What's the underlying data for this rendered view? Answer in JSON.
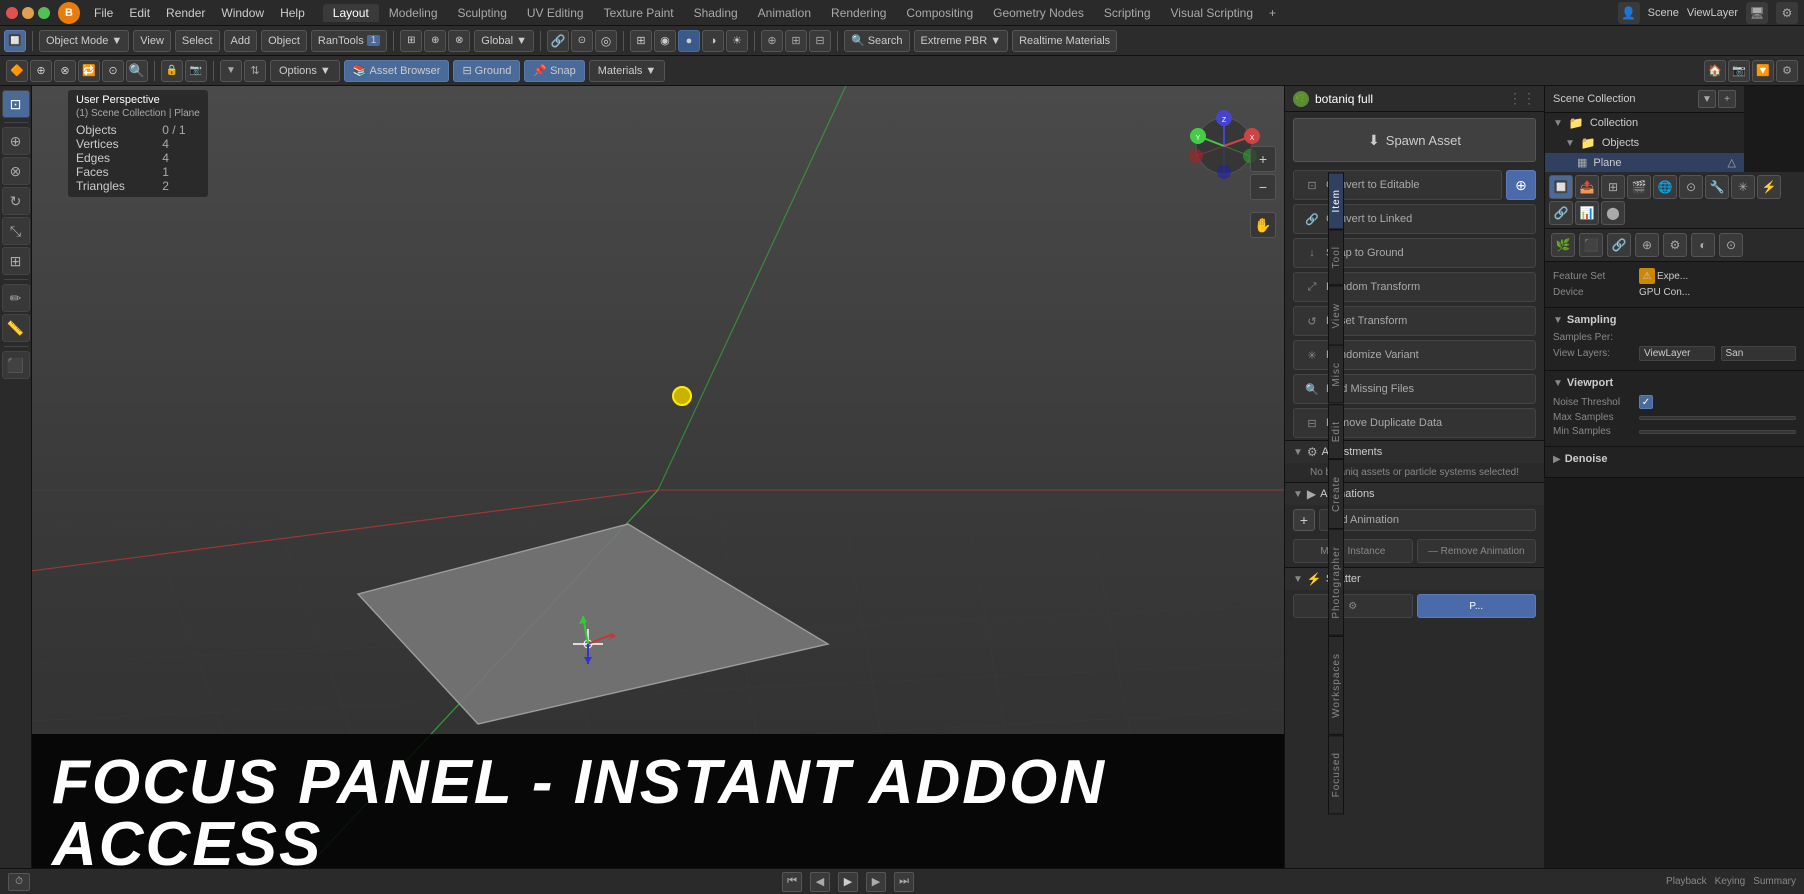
{
  "app": {
    "title": "Blender"
  },
  "top_menu": {
    "items": [
      "File",
      "Edit",
      "Render",
      "Window",
      "Help"
    ]
  },
  "workspace_tabs": {
    "tabs": [
      "Layout",
      "Modeling",
      "Sculpting",
      "UV Editing",
      "Texture Paint",
      "Shading",
      "Animation",
      "Rendering",
      "Compositing",
      "Geometry Nodes",
      "Scripting",
      "Visual Scripting"
    ],
    "active": "Layout",
    "plus_label": "+"
  },
  "toolbar": {
    "mode_label": "Object Mode",
    "view_label": "View",
    "select_label": "Select",
    "add_label": "Add",
    "object_label": "Object",
    "rantools_label": "RanTools",
    "global_label": "Global",
    "search_label": "Search",
    "extreme_pbr_label": "Extreme PBR",
    "realtime_materials_label": "Realtime Materials"
  },
  "editor_toolbar": {
    "options_label": "Options",
    "asset_browser_label": "Asset Browser",
    "ground_label": "Ground",
    "snap_label": "Snap",
    "materials_label": "Materials"
  },
  "info_panel": {
    "header": "User Perspective",
    "sub": "(1) Scene Collection | Plane",
    "rows": [
      {
        "label": "Objects",
        "value": "0 / 1"
      },
      {
        "label": "Vertices",
        "value": "4"
      },
      {
        "label": "Edges",
        "value": "4"
      },
      {
        "label": "Faces",
        "value": "1"
      },
      {
        "label": "Triangles",
        "value": "2"
      }
    ]
  },
  "botaniq_panel": {
    "title": "botaniq full",
    "spawn_asset_label": "Spawn Asset",
    "convert_to_editable_label": "Convert to Editable",
    "convert_to_linked_label": "Convert to Linked",
    "snap_to_ground_label": "Snap to Ground",
    "random_transform_label": "Random Transform",
    "reset_transform_label": "Reset Transform",
    "randomize_variant_label": "Randomize Variant",
    "find_missing_files_label": "Find Missing Files",
    "remove_duplicate_data_label": "Remove Duplicate Data",
    "adjustments_label": "Adjustments",
    "no_assets_text": "No botaniq assets or particle systems selected!",
    "animations_label": "Animations",
    "add_animation_label": "Add Animation",
    "make_instance_label": "Make Instance",
    "remove_animation_label": "— Remove Animation",
    "scatter_label": "Scatter"
  },
  "scene_sidebar": {
    "title": "Scene Collection",
    "items": [
      {
        "label": "Collection",
        "icon": "📁",
        "level": 0
      },
      {
        "label": "Objects",
        "icon": "📁",
        "level": 1
      },
      {
        "label": "Plane",
        "icon": "▦",
        "level": 2
      }
    ]
  },
  "right_edge_tabs": {
    "tabs": [
      "Item",
      "Tool",
      "View",
      "Misc",
      "Edit",
      "Create",
      "Photographer",
      "Workspaces",
      "Focused"
    ]
  },
  "props_panel": {
    "feature_set_label": "Feature Set",
    "experimental_label": "Expe...",
    "device_label": "Device",
    "gpu_label": "GPU Con...",
    "sampling_label": "Sampling",
    "samples_per_label": "Samples Per:",
    "view_layers_label": "View Layers:",
    "view_layer_value": "ViewLayer",
    "san_label": "San",
    "viewport_label": "Viewport",
    "noise_threshol_label": "Noise Threshol",
    "max_samples_label": "Max Samples",
    "min_samples_label": "Min Samples",
    "denoise_label": "Denoise"
  },
  "bottom_overlay": {
    "text": "FOCUS PANEL - Instant ADDON access"
  },
  "bottom_bar": {
    "playback_label": "Playback",
    "keying_label": "Keying",
    "summary_label": "Summary"
  },
  "icons": {
    "chevron_right": "▶",
    "chevron_down": "▼",
    "plus": "+",
    "minus": "−",
    "link": "🔗",
    "arrow_down": "↓",
    "shuffle": "⤢",
    "reset": "↺",
    "asterisk": "✳",
    "search": "🔍",
    "trash": "🗑",
    "warning": "⚠",
    "checkbox_checked": "✓",
    "dots": "⋮⋮"
  }
}
